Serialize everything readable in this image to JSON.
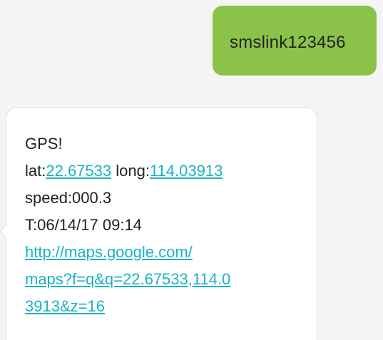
{
  "conversation": {
    "outgoing": {
      "text": "smslink123456",
      "bubble_color": "#8bc34a"
    },
    "incoming": {
      "title": "GPS!",
      "lat_label": "lat:",
      "lat_value": "22.67533",
      "long_label": " long:",
      "long_value": "114.03913",
      "speed": "speed:000.3",
      "time": "T:06/14/17 09:14",
      "url_line1": "http://maps.google.com/",
      "url_line2": "maps?f=q&q=22.67533,114.0",
      "url_line3": "3913&z=16",
      "link_color": "#1ab2c0"
    }
  }
}
